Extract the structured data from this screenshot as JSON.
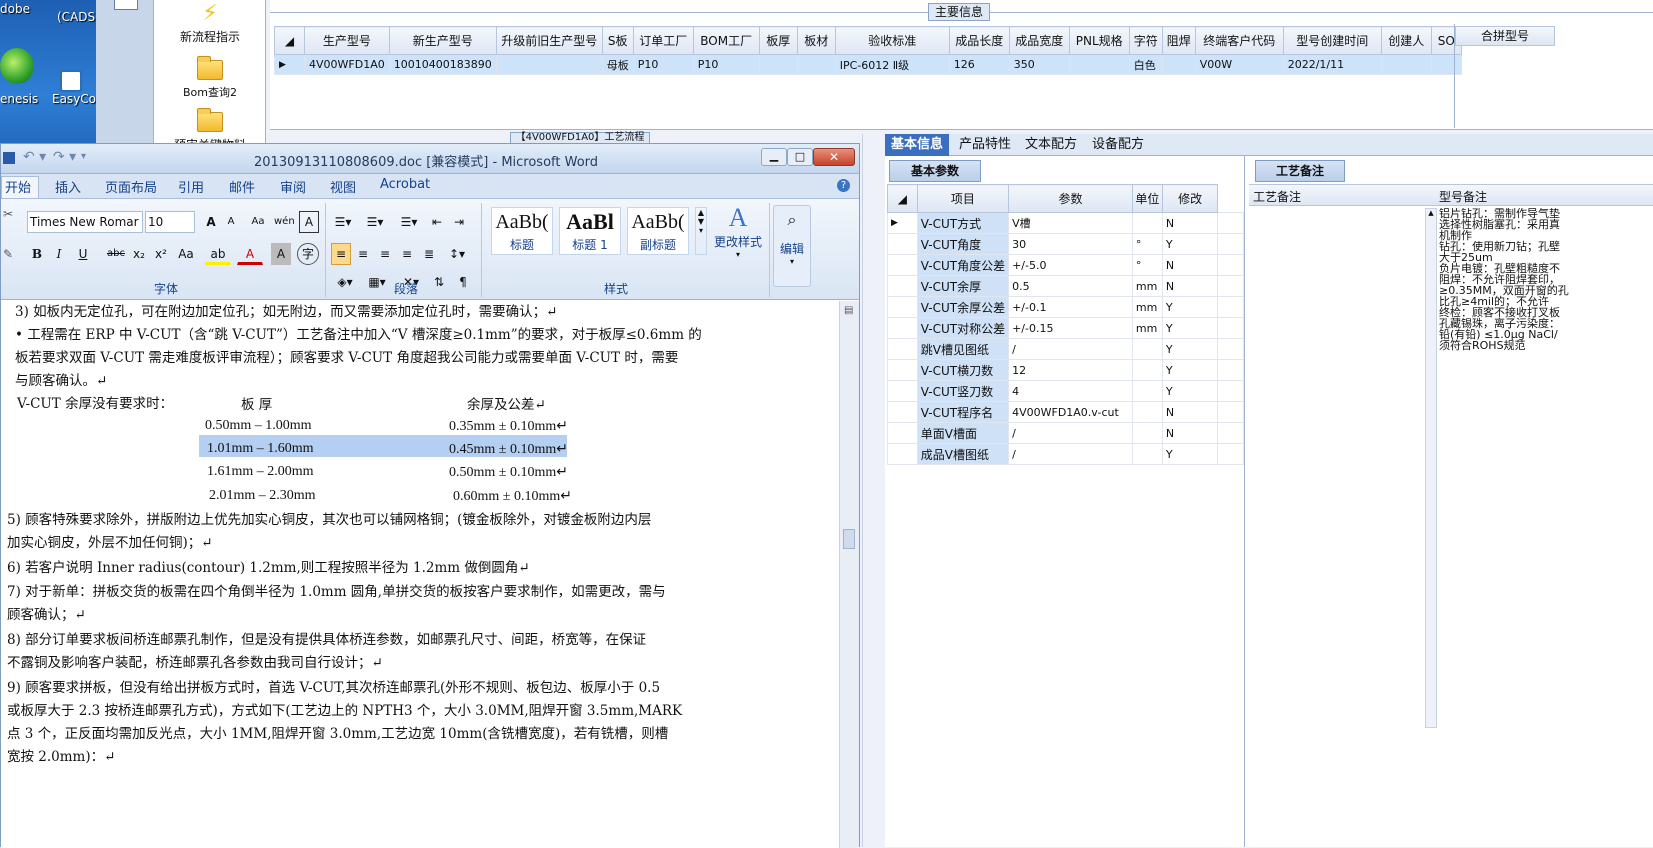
{
  "desktop": {
    "icons": [
      {
        "label": "dobe"
      },
      {
        "label": "(CADS"
      },
      {
        "label": "enesis"
      },
      {
        "label": "EasyCo"
      }
    ]
  },
  "left_tools": [
    {
      "label": "新流程指示",
      "icon": "lightning-icon"
    },
    {
      "label": "Bom查询2",
      "icon": "folder-icon"
    },
    {
      "label": "预审关键物料",
      "icon": "folder-icon"
    }
  ],
  "top_grid": {
    "title": "主要信息",
    "headers": [
      "生产型号",
      "新生产型号",
      "升级前旧生产型号",
      "S板",
      "订单工厂",
      "BOM工厂",
      "板厚",
      "板材",
      "验收标准",
      "成品长度",
      "成品宽度",
      "PNL规格",
      "字符",
      "阻焊",
      "终端客户代码",
      "型号创建时间",
      "创建人",
      "SO"
    ],
    "row": [
      "4V00WFD1A0",
      "10010400183890",
      "",
      "母板",
      "P10",
      "P10",
      "",
      "",
      "IPC-6012 Ⅱ级",
      "126",
      "350",
      "",
      "白色",
      "",
      "V00W",
      "2022/1/11",
      "",
      ""
    ],
    "side_header": "合拼型号",
    "tab_label": "【4V00WFD1A0】工艺流程"
  },
  "word": {
    "title": "20130913110808609.doc [兼容模式] - Microsoft Word",
    "tabs": [
      "开始",
      "插入",
      "页面布局",
      "引用",
      "邮件",
      "审阅",
      "视图",
      "Acrobat"
    ],
    "font_name": "Times New Romar",
    "font_size": "10",
    "groups": [
      "字体",
      "段落",
      "样式"
    ],
    "styles": [
      {
        "preview": "AaBb(",
        "label": "标题"
      },
      {
        "preview": "AaBl",
        "label": "标题 1"
      },
      {
        "preview": "AaBb(",
        "label": "副标题"
      }
    ],
    "change_styles": "更改样式",
    "edit": "编辑",
    "lines": [
      "3)  如板内无定位孔，可在附边加定位孔；如无附边，而又需要添加定位孔时，需要确认；↵",
      "•  工程需在 ERP 中 V-CUT（含“跳 V-CUT”）工艺备注中加入“V 槽深度≥0.1mm”的要求，对于板厚≤0.6mm 的",
      "   板若要求双面 V-CUT 需走难度板评审流程）；顾客要求 V-CUT 角度超我公司能力或需要单面 V-CUT 时，需要",
      "   与顾客确认。↵"
    ],
    "vcut_intro": "V-CUT 余厚没有要求时：",
    "vcut_head": [
      "板  厚",
      "余厚及公差↵"
    ],
    "vcut_rows": [
      [
        "0.50mm – 1.00mm",
        "0.35mm ± 0.10mm↵"
      ],
      [
        "1.01mm – 1.60mm",
        "0.45mm ± 0.10mm↵"
      ],
      [
        "1.61mm – 2.00mm",
        "0.50mm ± 0.10mm↵"
      ],
      [
        "2.01mm – 2.30mm",
        "0.60mm ± 0.10mm↵"
      ]
    ],
    "lines2": [
      "5)  顾客特殊要求除外，拼版附边上优先加实心铜皮，其次也可以铺网格铜；(镀金板除外，对镀金板附边内层",
      "    加实心铜皮，外层不加任何铜)；↵",
      "6)  若客户说明 Inner radius(contour) 1.2mm,则工程按照半径为 1.2mm 做倒圆角↵",
      "7)  对于新单：拼板交货的板需在四个角倒半径为 1.0mm 圆角,单拼交货的板按客户要求制作，如需更改，需与",
      "    顾客确认；↵",
      "8)  部分订单要求板间桥连邮票孔制作，但是没有提供具体桥连参数，如邮票孔尺寸、间距，桥宽等，在保证",
      "    不露铜及影响客户装配，桥连邮票孔各参数由我司自行设计；↵",
      "9)  顾客要求拼板，但没有给出拼板方式时，首选 V-CUT,其次桥连邮票孔(外形不规则、板包边、板厚小于 0.5",
      "    或板厚大于 2.3 按桥连邮票孔方式)，方式如下(工艺边上的 NPTH3 个，大小 3.0MM,阻焊开窗 3.5mm,MARK",
      "    点 3 个，正反面均需加反光点，大小 1MM,阻焊开窗 3.0mm,工艺边宽 10mm(含铣槽宽度)，若有铣槽，则槽",
      "    宽按 2.0mm)：↵"
    ]
  },
  "right": {
    "tabs": [
      "基本信息",
      "产品特性",
      "文本配方",
      "设备配方"
    ],
    "param_title": "基本参数",
    "headers": [
      "项目",
      "参数",
      "单位",
      "修改"
    ],
    "rows": [
      [
        "V-CUT方式",
        "V槽",
        "",
        "N"
      ],
      [
        "V-CUT角度",
        "30",
        "°",
        "Y"
      ],
      [
        "V-CUT角度公差",
        "+/-5.0",
        "°",
        "N"
      ],
      [
        "V-CUT余厚",
        "0.5",
        "mm",
        "N"
      ],
      [
        "V-CUT余厚公差",
        "+/-0.1",
        "mm",
        "Y"
      ],
      [
        "V-CUT对称公差",
        "+/-0.15",
        "mm",
        "Y"
      ],
      [
        "跳V槽见图纸",
        "/",
        "",
        "Y"
      ],
      [
        "V-CUT横刀数",
        "12",
        "",
        "Y"
      ],
      [
        "V-CUT竖刀数",
        "4",
        "",
        "Y"
      ],
      [
        "V-CUT程序名",
        "4V00WFD1A0.v-cut",
        "",
        "N"
      ],
      [
        "单面V槽面",
        "/",
        "",
        "N"
      ],
      [
        "成品V槽图纸",
        "/",
        "",
        "Y"
      ]
    ],
    "craft_title": "工艺备注",
    "craft_headers": [
      "工艺备注",
      "型号备注"
    ],
    "model_notes": [
      "铝片钻孔：需制作导气垫",
      "选择性树脂塞孔：采用真",
      "机制作",
      "钻孔：使用新刀钻；孔壁",
      "大于25um",
      "负片电镀：孔壁粗糙度不",
      "阻焊：不允许阻焊套印，",
      "≥0.35MM，双面开窗的孔",
      "比孔≥4mil的；不允许",
      "终检：顾客不接收打叉板",
      "孔藏锡珠，离子污染度：",
      "铅(有铅) ≤1.0μg NaCl/",
      "须符合ROHS规范"
    ]
  },
  "colors": {
    "accent": "#15428b",
    "selection": "#cde3fa",
    "param_name_bg": "#cfe1f6"
  }
}
